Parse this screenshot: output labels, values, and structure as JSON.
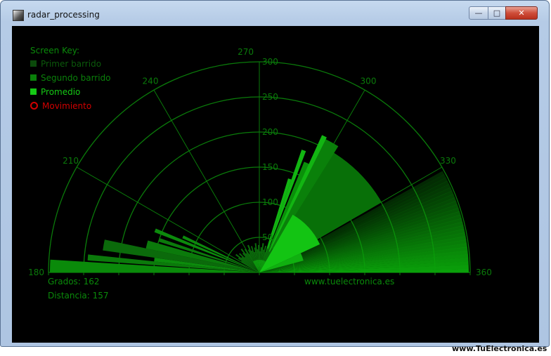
{
  "window": {
    "title": "radar_processing",
    "controls": {
      "minimize": "—",
      "maximize": "□",
      "close": "✕"
    }
  },
  "screen_key": {
    "title": "Screen Key:",
    "items": [
      {
        "label": "Primer barrido",
        "color": "#0b4a0b",
        "text_color": "#0b5a0b"
      },
      {
        "label": "Segundo barrido",
        "color": "#0a800a",
        "text_color": "#0a800a"
      },
      {
        "label": "Promedio",
        "color": "#15c915",
        "text_color": "#15c915"
      },
      {
        "label": "Movimiento",
        "color": "#d00000",
        "text_color": "#d00000"
      }
    ]
  },
  "radar": {
    "angle_labels": [
      "180",
      "210",
      "240",
      "270",
      "300",
      "330",
      "360"
    ],
    "distance_labels": [
      "50",
      "100",
      "150",
      "200",
      "250",
      "300"
    ],
    "grid_color": "#0a7a0a"
  },
  "readout": {
    "grados": "Grados: 162",
    "distancia": "Distancia: 157"
  },
  "site": "www.tuelectronica.es",
  "watermark": "www.TuElectronica.es"
}
